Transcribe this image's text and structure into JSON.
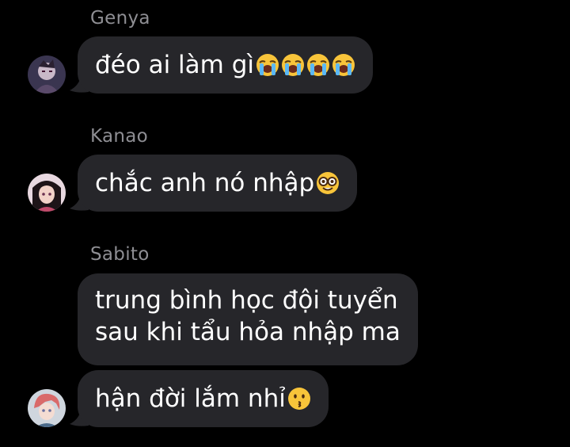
{
  "messages": [
    {
      "sender": "Genya",
      "lines": [
        "đéo ai làm gì"
      ],
      "emojis": [
        "loudly-crying-face-icon",
        "loudly-crying-face-icon",
        "loudly-crying-face-icon",
        "loudly-crying-face-icon"
      ]
    },
    {
      "sender": "Kanao",
      "lines": [
        "chắc anh nó nhập"
      ],
      "emojis": [
        "nerd-face-icon"
      ]
    },
    {
      "sender": "Sabito",
      "lines": [
        "trung bình học đội tuyển",
        "sau khi tẩu hỏa nhập ma"
      ],
      "emojis": []
    },
    {
      "sender": "",
      "lines": [
        "hận đời lắm nhỉ"
      ],
      "emojis": [
        "kissing-face-icon"
      ]
    }
  ],
  "colors": {
    "background": "#000000",
    "bubble": "#26262a",
    "sender_name": "#8e8e93",
    "text": "#ffffff"
  }
}
